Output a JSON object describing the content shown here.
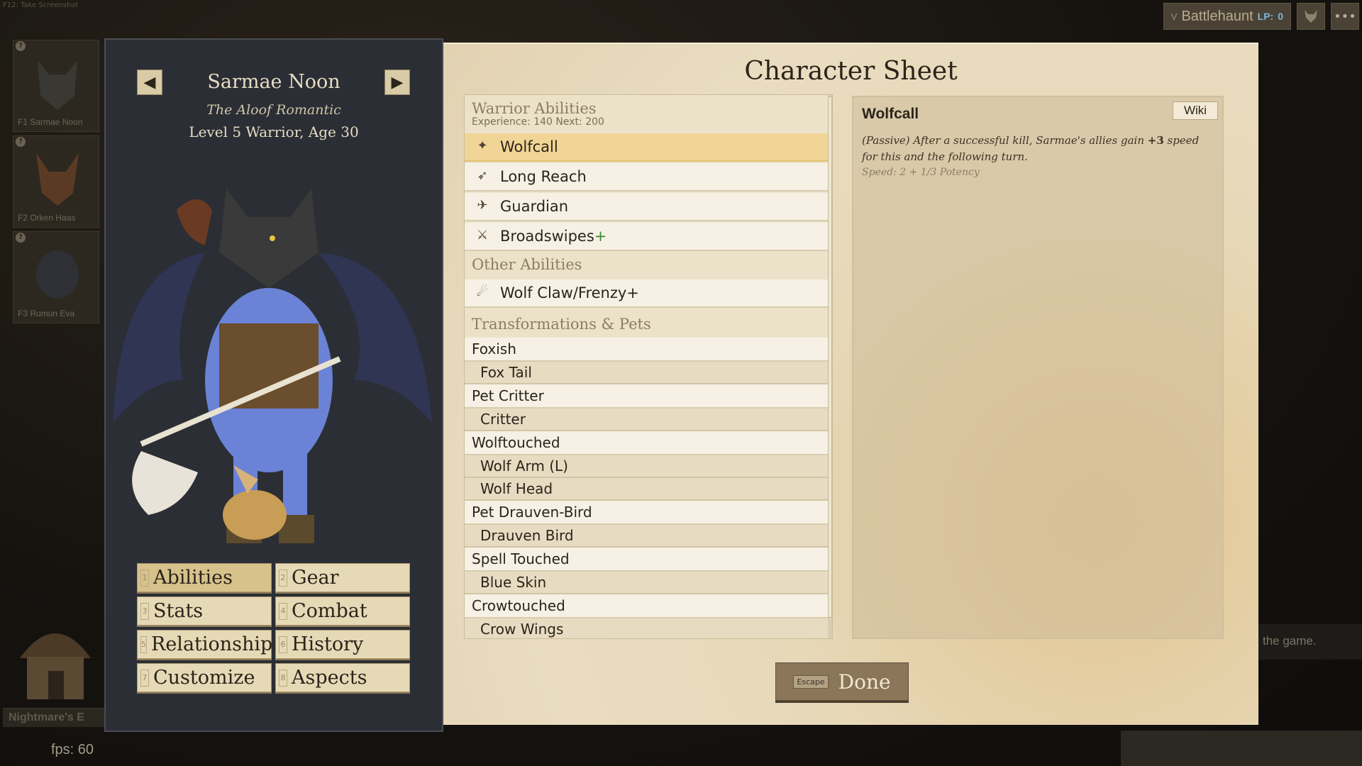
{
  "top_hint": "F12: Take Screenshot",
  "topbar": {
    "key": "V",
    "label": "Battlehaunt",
    "lp_label": "LP:",
    "lp_value": "0",
    "menu_glyph": "•••"
  },
  "party": [
    {
      "badge": "?",
      "label": "F1 Sarmae Noon"
    },
    {
      "badge": "?",
      "label": "F2 Orken Haas"
    },
    {
      "badge": "?",
      "label": "F3 Rumun Eva"
    }
  ],
  "character": {
    "name": "Sarmae Noon",
    "epithet": "The Aloof Romantic",
    "summary": "Level 5 Warrior, Age 30",
    "prev_glyph": "◀",
    "next_glyph": "▶"
  },
  "menu": [
    {
      "key": "1",
      "label": "Abilities",
      "active": true
    },
    {
      "key": "2",
      "label": "Gear"
    },
    {
      "key": "3",
      "label": "Stats"
    },
    {
      "key": "4",
      "label": "Combat"
    },
    {
      "key": "5",
      "label": "Relationships"
    },
    {
      "key": "6",
      "label": "History"
    },
    {
      "key": "7",
      "label": "Customize"
    },
    {
      "key": "8",
      "label": "Aspects"
    }
  ],
  "sheet": {
    "title": "Character Sheet",
    "warrior": {
      "heading": "Warrior Abilities",
      "experience": "Experience: 140   Next: 200",
      "items": [
        {
          "label": "Wolfcall",
          "icon": "wolf-howl-icon",
          "glyph": "✦"
        },
        {
          "label": "Long Reach",
          "icon": "spear-icon",
          "glyph": "➶"
        },
        {
          "label": "Guardian",
          "icon": "shield-guard-icon",
          "glyph": "✈"
        },
        {
          "label": "Broadswipes",
          "suffix": "+",
          "icon": "sword-swipe-icon",
          "glyph": "⚔"
        }
      ]
    },
    "other": {
      "heading": "Other Abilities",
      "items": [
        {
          "label": "Wolf Claw/Frenzy+",
          "icon": "claw-icon",
          "glyph": "☄"
        }
      ]
    },
    "transformations": {
      "heading": "Transformations & Pets",
      "rows": [
        {
          "label": "Foxish",
          "child": false
        },
        {
          "label": "Fox Tail",
          "child": true
        },
        {
          "label": "Pet Critter",
          "child": false
        },
        {
          "label": "Critter",
          "child": true
        },
        {
          "label": "Wolftouched",
          "child": false
        },
        {
          "label": "Wolf Arm (L)",
          "child": true
        },
        {
          "label": "Wolf Head",
          "child": true
        },
        {
          "label": "Pet Drauven-Bird",
          "child": false
        },
        {
          "label": "Drauven Bird",
          "child": true
        },
        {
          "label": "Spell Touched",
          "child": false
        },
        {
          "label": "Blue Skin",
          "child": true
        },
        {
          "label": "Crowtouched",
          "child": false
        },
        {
          "label": "Crow Wings",
          "child": true
        }
      ]
    },
    "detail": {
      "title": "Wolfcall",
      "wiki": "Wiki",
      "desc_a": "(Passive) After a successful kill, Sarmae's allies gain ",
      "desc_b": "+3",
      "desc_c": " speed for this and the following turn.",
      "note": "Speed: 2 + 1/3 Potency"
    },
    "done": {
      "key": "Escape",
      "label": "Done"
    }
  },
  "footer": {
    "fps": "fps: 60",
    "nightmare": "Nightmare's E",
    "side_text": "the game."
  },
  "colors": {
    "accent_selected": "#f1d596",
    "panel_dark": "#2b2e34",
    "parchment": "#e9dcc0",
    "plus_green": "#3d8a2c"
  }
}
